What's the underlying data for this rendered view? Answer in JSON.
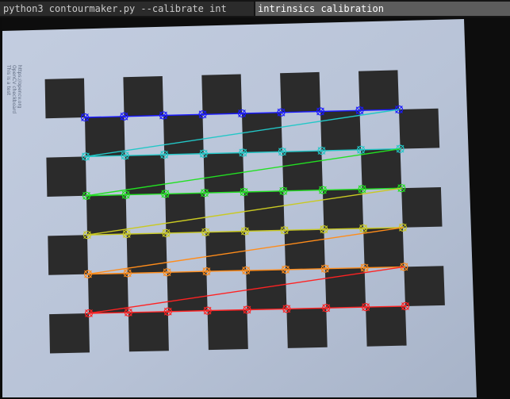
{
  "terminal": {
    "title": "python3 contourmaker.py --calibrate int"
  },
  "window": {
    "title": "intrinsics calibration"
  },
  "paper_note": {
    "lines": [
      "This is a test",
      "OpenCV checkboard",
      "https://opencv.org"
    ]
  },
  "corner_rows": [
    {
      "color": "#1a1aff",
      "count": 9
    },
    {
      "color": "#22c7c7",
      "count": 9
    },
    {
      "color": "#22e022",
      "count": 9
    },
    {
      "color": "#c9c922",
      "count": 9
    },
    {
      "color": "#ff8c1a",
      "count": 9
    },
    {
      "color": "#ff2222",
      "count": 9
    }
  ],
  "colors": {
    "paper": "#b8c3d6",
    "square": "#2b2b2b",
    "background": "#0c0c0c"
  }
}
